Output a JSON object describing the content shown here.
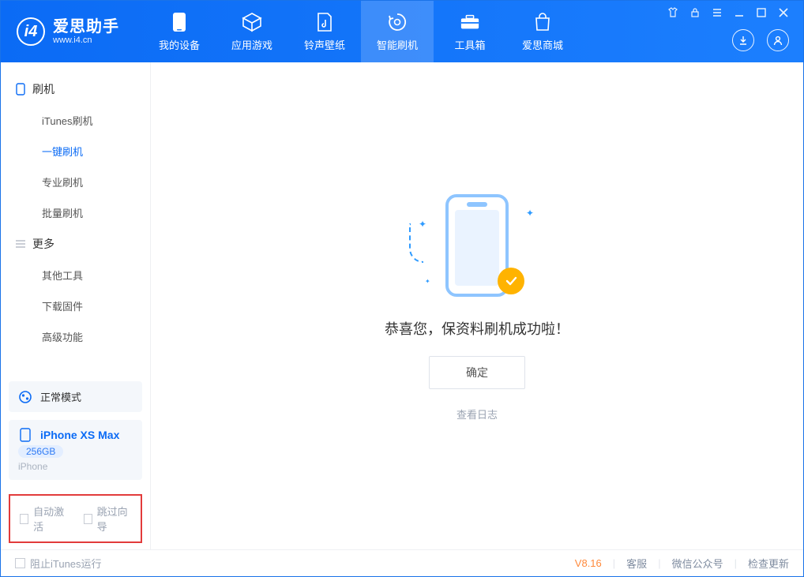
{
  "brand": {
    "title": "爱思助手",
    "subtitle": "www.i4.cn"
  },
  "nav": {
    "my_device": "我的设备",
    "apps_games": "应用游戏",
    "ring_wall": "铃声壁纸",
    "smart_flash": "智能刷机",
    "toolbox": "工具箱",
    "store": "爱思商城"
  },
  "sidebar": {
    "section_flash": "刷机",
    "items_flash": {
      "itunes": "iTunes刷机",
      "oneclick": "一键刷机",
      "pro": "专业刷机",
      "batch": "批量刷机"
    },
    "section_more": "更多",
    "items_more": {
      "other_tools": "其他工具",
      "download_fw": "下载固件",
      "advanced": "高级功能"
    },
    "mode_card": "正常模式",
    "device": {
      "name": "iPhone XS Max",
      "capacity": "256GB",
      "type": "iPhone"
    },
    "auto_activate": "自动激活",
    "skip_guide": "跳过向导"
  },
  "main": {
    "success": "恭喜您，保资料刷机成功啦！",
    "confirm": "确定",
    "view_log": "查看日志"
  },
  "footer": {
    "block_itunes": "阻止iTunes运行",
    "version": "V8.16",
    "support": "客服",
    "wechat": "微信公众号",
    "check_update": "检查更新"
  },
  "colors": {
    "primary": "#0b6bf5",
    "accent": "#ffb300"
  }
}
